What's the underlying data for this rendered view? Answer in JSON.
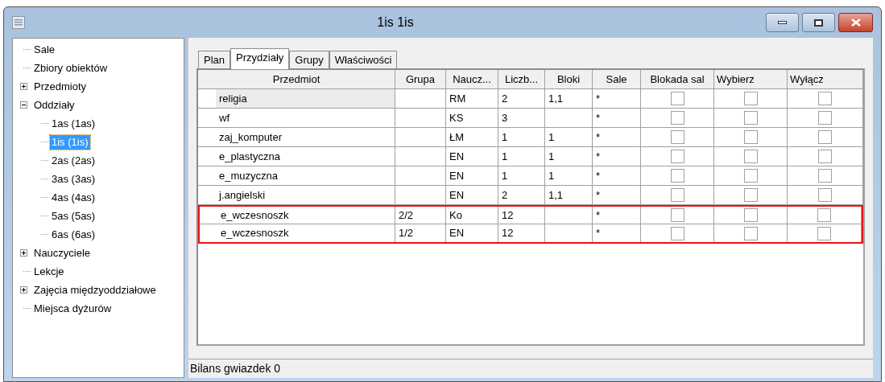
{
  "window": {
    "title": "1is 1is"
  },
  "tree": [
    {
      "label": "Sale",
      "selected": false
    },
    {
      "label": "Zbiory obiektów",
      "selected": false
    },
    {
      "label": "Przedmioty",
      "selected": false,
      "expanded": false
    },
    {
      "label": "Oddziały",
      "selected": false,
      "expanded": true,
      "children": [
        {
          "label": "1as (1as)",
          "selected": false
        },
        {
          "label": "1is (1is)",
          "selected": true
        },
        {
          "label": "2as (2as)",
          "selected": false
        },
        {
          "label": "3as (3as)",
          "selected": false
        },
        {
          "label": "4as (4as)",
          "selected": false
        },
        {
          "label": "5as (5as)",
          "selected": false
        },
        {
          "label": "6as (6as)",
          "selected": false
        }
      ]
    },
    {
      "label": "Nauczyciele",
      "selected": false,
      "expanded": false
    },
    {
      "label": "Lekcje",
      "selected": false
    },
    {
      "label": "Zajęcia międzyoddziałowe",
      "selected": false,
      "expanded": false
    },
    {
      "label": "Miejsca dyżurów",
      "selected": false
    }
  ],
  "tabs": [
    {
      "label": "Plan",
      "selected": false
    },
    {
      "label": "Przydziały",
      "selected": true
    },
    {
      "label": "Grupy",
      "selected": false
    },
    {
      "label": "Właściwości",
      "selected": false
    }
  ],
  "table": {
    "columns": [
      "Przedmiot",
      "Grupa",
      "Naucz...",
      "Liczb...",
      "Bloki",
      "Sale",
      "Blokada sal",
      "Wybierz",
      "Wyłącz"
    ],
    "rows": [
      {
        "cells": [
          "religia",
          "",
          "RM",
          "2",
          "1,1",
          "*"
        ],
        "checks": [
          false,
          false,
          false
        ],
        "selected": true,
        "highlighted": false
      },
      {
        "cells": [
          "wf",
          "",
          "KS",
          "3",
          "",
          "*"
        ],
        "checks": [
          false,
          false,
          false
        ],
        "selected": false,
        "highlighted": false
      },
      {
        "cells": [
          "zaj_komputer",
          "",
          "ŁM",
          "1",
          "1",
          "*"
        ],
        "checks": [
          false,
          false,
          false
        ],
        "selected": false,
        "highlighted": false
      },
      {
        "cells": [
          "e_plastyczna",
          "",
          "EN",
          "1",
          "1",
          "*"
        ],
        "checks": [
          false,
          false,
          false
        ],
        "selected": false,
        "highlighted": false
      },
      {
        "cells": [
          "e_muzyczna",
          "",
          "EN",
          "1",
          "1",
          "*"
        ],
        "checks": [
          false,
          false,
          false
        ],
        "selected": false,
        "highlighted": false
      },
      {
        "cells": [
          "j.angielski",
          "",
          "EN",
          "2",
          "1,1",
          "*"
        ],
        "checks": [
          false,
          false,
          false
        ],
        "selected": false,
        "highlighted": false
      },
      {
        "cells": [
          "e_wczesnoszk",
          "2/2",
          "Ko",
          "12",
          "",
          "*"
        ],
        "checks": [
          false,
          false,
          false
        ],
        "selected": false,
        "highlighted": true
      },
      {
        "cells": [
          "e_wczesnoszk",
          "1/2",
          "EN",
          "12",
          "",
          "*"
        ],
        "checks": [
          false,
          false,
          false
        ],
        "selected": false,
        "highlighted": true
      }
    ]
  },
  "status_bar": "Bilans gwiazdek 0"
}
